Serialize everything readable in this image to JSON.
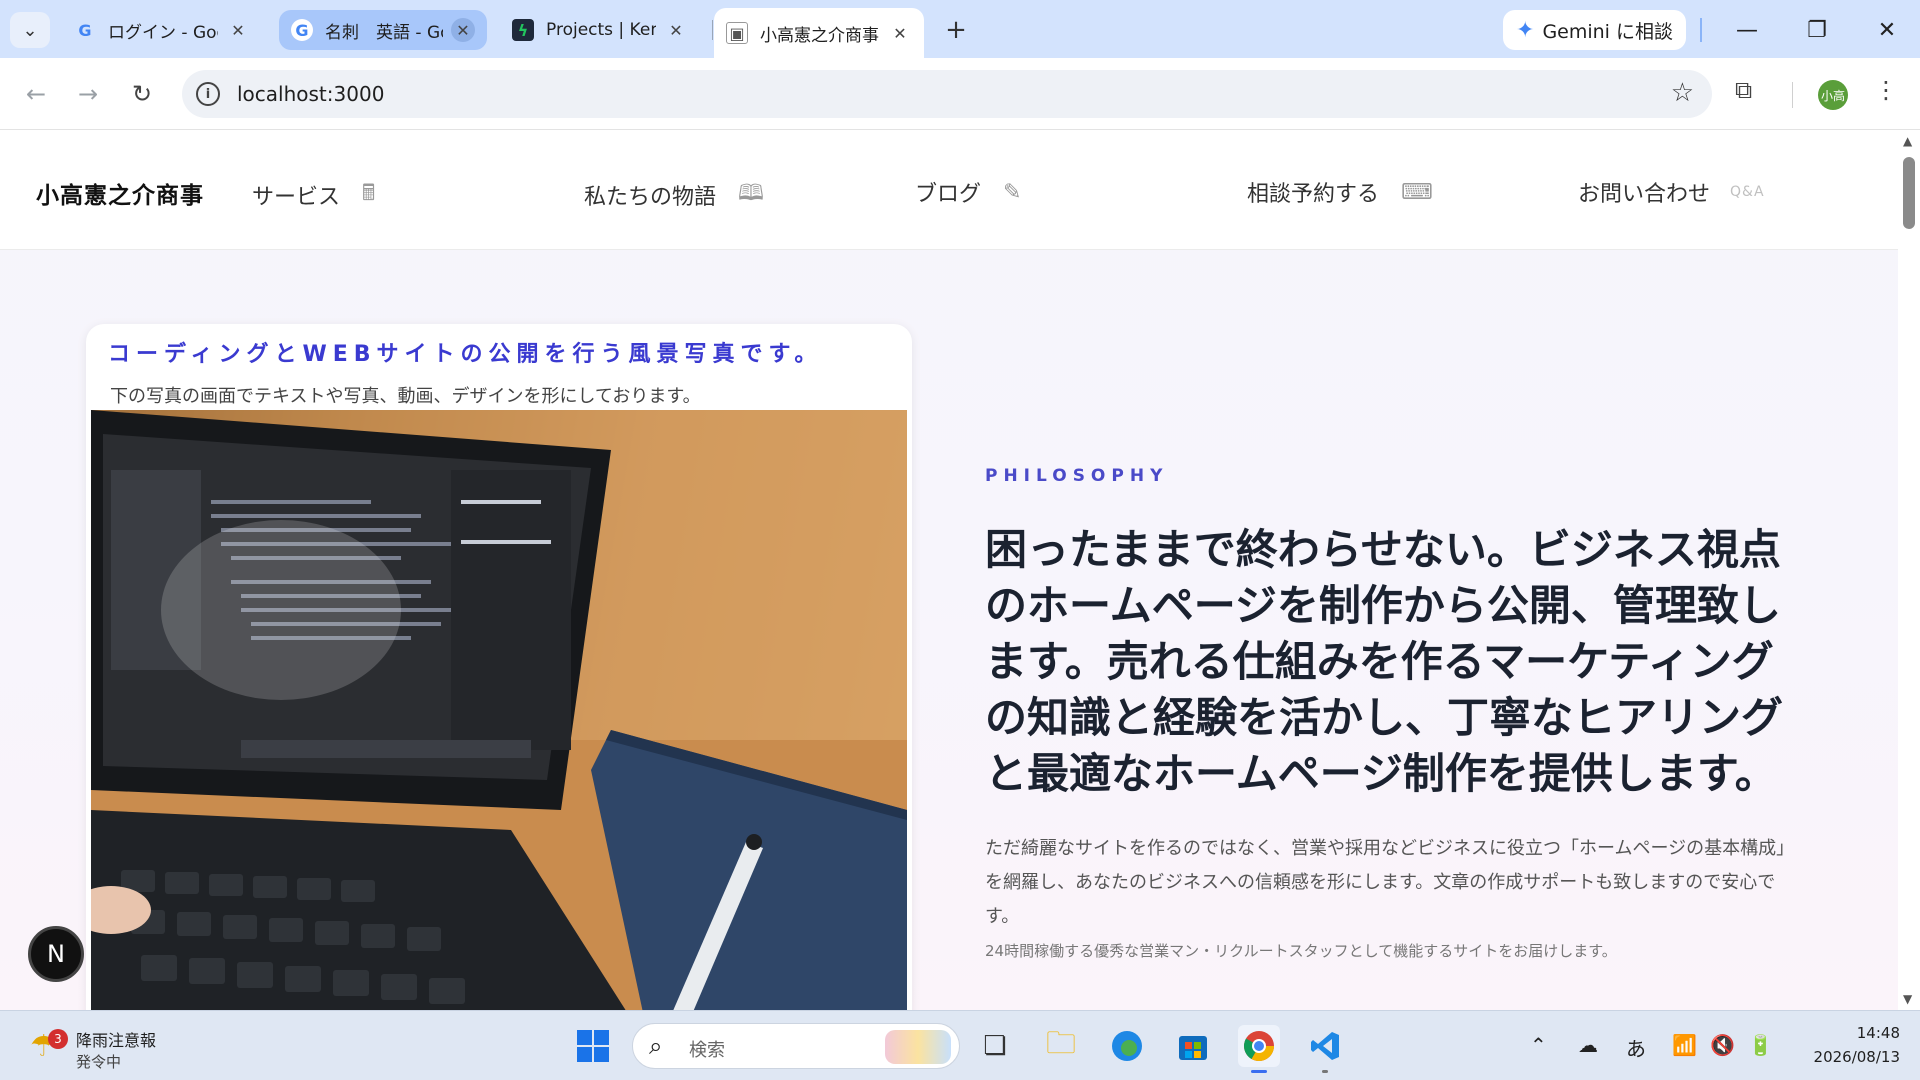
{
  "browser": {
    "tabs": [
      {
        "title": "ログイン - Google",
        "favicon": "G",
        "favicon_color": "#4285f4",
        "state": "normal"
      },
      {
        "title": "名刺　英語 - Google",
        "favicon": "G",
        "favicon_color": "#4285f4",
        "state": "highlighted"
      },
      {
        "title": "Projects | Kenji",
        "favicon": "ϟ",
        "favicon_color": "#22c55e",
        "state": "normal"
      },
      {
        "title": "小高憲之介商事",
        "favicon": "▣",
        "favicon_color": "#555555",
        "state": "active"
      }
    ],
    "gemini_label": "Gemini に相談",
    "url": "localhost:3000",
    "profile_initials": "小高"
  },
  "site": {
    "brand": "小高憲之介商事",
    "nav": [
      {
        "label": "サービス",
        "icon": "calculator-icon"
      },
      {
        "label": "私たちの物語",
        "icon": "book-icon"
      },
      {
        "label": "ブログ",
        "icon": "pen-icon"
      },
      {
        "label": "相談予約する",
        "icon": "keyboard-icon"
      },
      {
        "label": "お問い合わせ",
        "icon": "qa-icon",
        "icon_text": "Q&A"
      }
    ],
    "card": {
      "title": "コーディングとWEBサイトの公開を行う風景写真です。",
      "subtitle": "下の写真の画面でテキストや写真、動画、デザインを形にしております。"
    },
    "philosophy": {
      "eyebrow": "PHILOSOPHY",
      "headline": "困ったままで終わらせない。ビジネス視点のホームページを制作から公開、管理致します。売れる仕組みを作るマーケティングの知識と経験を活かし、丁寧なヒアリングと最適なホームページ制作を提供します。",
      "body": "ただ綺麗なサイトを作るのではなく、営業や採用などビジネスに役立つ「ホームページの基本構成」を網羅し、あなたのビジネスへの信頼感を形にします。文章の作成サポートも致しますので安心です。",
      "note": "24時間稼働する優秀な営業マン・リクルートスタッフとして機能するサイトをお届けします。"
    },
    "badge": "N"
  },
  "taskbar": {
    "weather_title": "降雨注意報",
    "weather_sub": "発令中",
    "weather_badge": "3",
    "search_placeholder": "検索",
    "ime": "あ",
    "time": "14:48",
    "date": "2026/08/13"
  },
  "colors": {
    "accent": "#3a3ad0",
    "tabstrip": "#d3e3fd"
  }
}
